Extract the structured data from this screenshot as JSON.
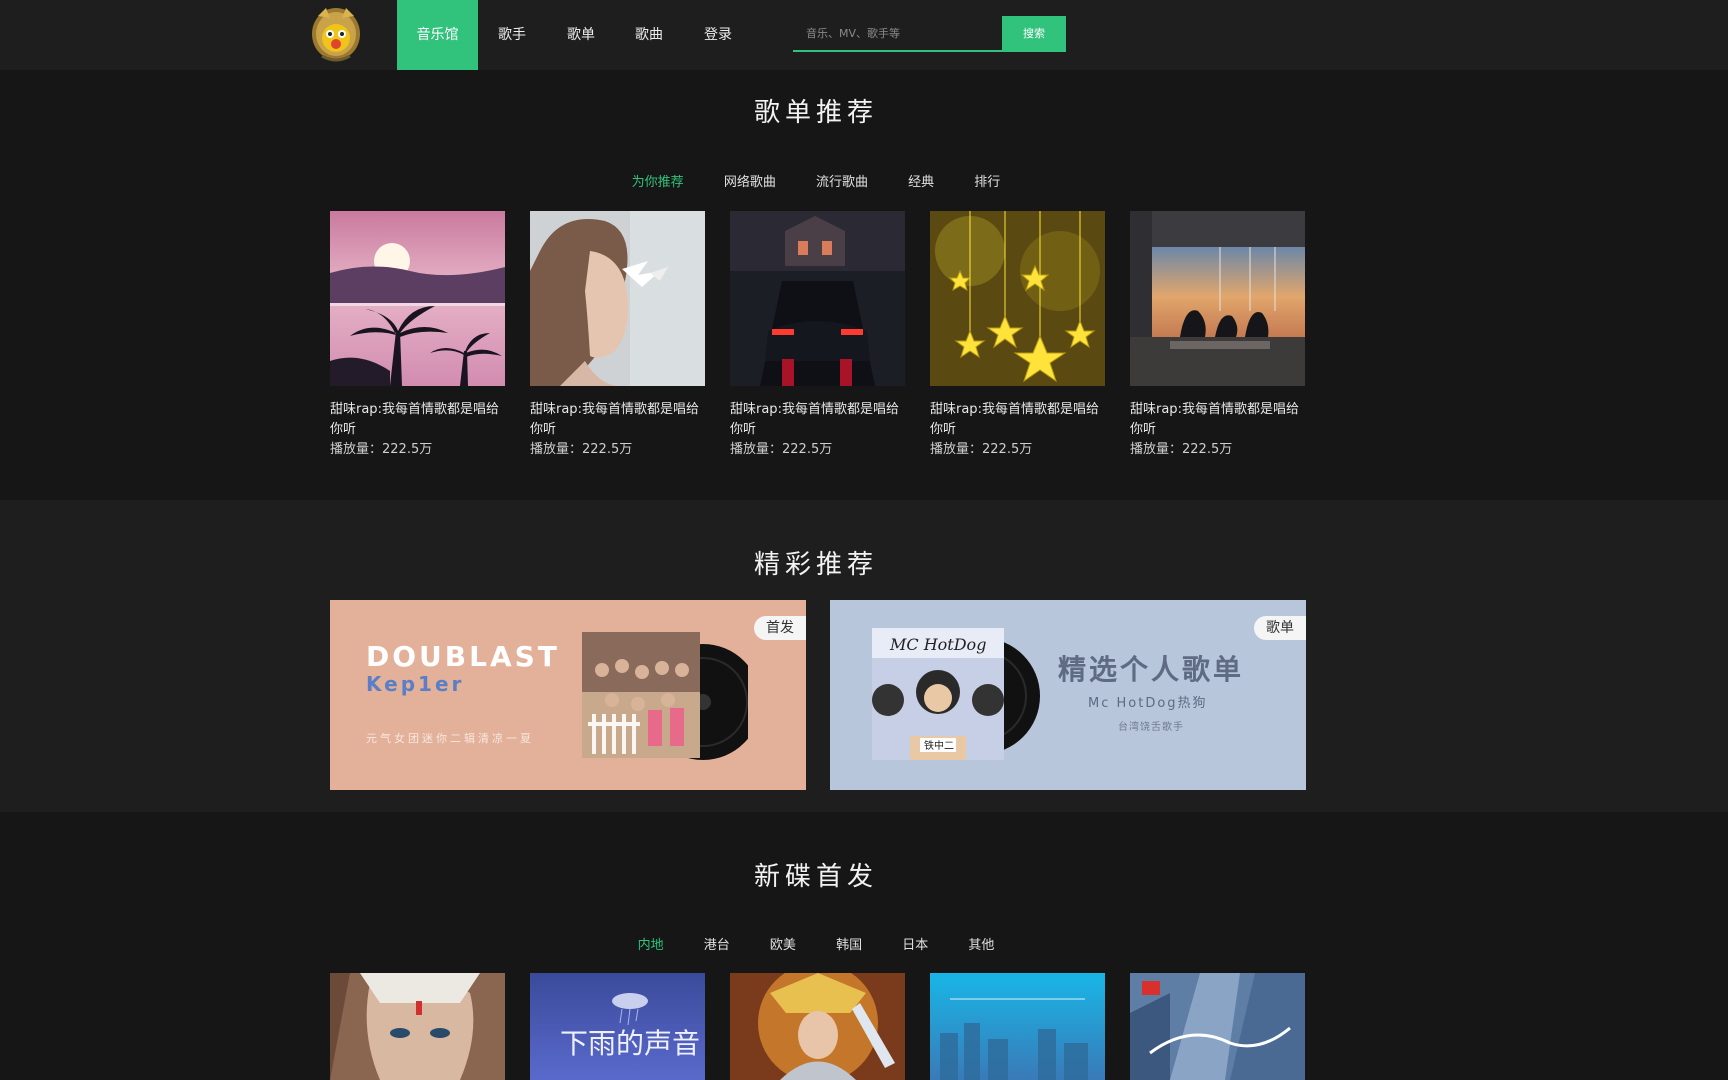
{
  "nav": {
    "items": [
      {
        "label": "音乐馆",
        "active": true
      },
      {
        "label": "歌手",
        "active": false
      },
      {
        "label": "歌单",
        "active": false
      },
      {
        "label": "歌曲",
        "active": false
      },
      {
        "label": "登录",
        "active": false
      }
    ],
    "search_placeholder": "音乐、MV、歌手等",
    "search_button": "搜索"
  },
  "playlist_section": {
    "title": "歌单推荐",
    "tabs": [
      {
        "label": "为你推荐",
        "active": true
      },
      {
        "label": "网络歌曲",
        "active": false
      },
      {
        "label": "流行歌曲",
        "active": false
      },
      {
        "label": "经典",
        "active": false
      },
      {
        "label": "排行",
        "active": false
      }
    ],
    "cards": [
      {
        "name": "甜味rap:我每首情歌都是唱给你听",
        "plays": "播放量：222.5万",
        "cover": "sunset-palm-cover"
      },
      {
        "name": "甜味rap:我每首情歌都是唱给你听",
        "plays": "播放量：222.5万",
        "cover": "girl-portrait-cover"
      },
      {
        "name": "甜味rap:我每首情歌都是唱给你听",
        "plays": "播放量：222.5万",
        "cover": "night-car-cover"
      },
      {
        "name": "甜味rap:我每首情歌都是唱给你听",
        "plays": "播放量：222.5万",
        "cover": "golden-stars-cover"
      },
      {
        "name": "甜味rap:我每首情歌都是唱给你听",
        "plays": "播放量：222.5万",
        "cover": "cafe-sunset-cover"
      }
    ]
  },
  "featured_section": {
    "title": "精彩推荐",
    "banners": [
      {
        "tag": "首发",
        "headline": "DOUBLAST",
        "artist": "Kep1er",
        "caption": "元气女团迷你二辑清凉一夏"
      },
      {
        "tag": "歌单",
        "headline": "精选个人歌单",
        "artist": "Mc HotDog热狗",
        "caption": "台湾饶舌歌手",
        "album_text": "MC HotDog",
        "album_subtext": "铁中二"
      }
    ]
  },
  "album_section": {
    "title": "新碟首发",
    "tabs": [
      {
        "label": "内地",
        "active": true
      },
      {
        "label": "港台",
        "active": false
      },
      {
        "label": "欧美",
        "active": false
      },
      {
        "label": "韩国",
        "active": false
      },
      {
        "label": "日本",
        "active": false
      },
      {
        "label": "其他",
        "active": false
      }
    ],
    "albums": [
      {
        "cover": "warrior-cover"
      },
      {
        "cover": "rain-sound-cover",
        "text": "下雨的声音"
      },
      {
        "cover": "goddess-cover"
      },
      {
        "cover": "blue-city-cover"
      },
      {
        "cover": "skyscraper-cover"
      }
    ]
  },
  "colors": {
    "accent": "#31c27c",
    "background": "#161616",
    "header": "#1e1e1e"
  }
}
